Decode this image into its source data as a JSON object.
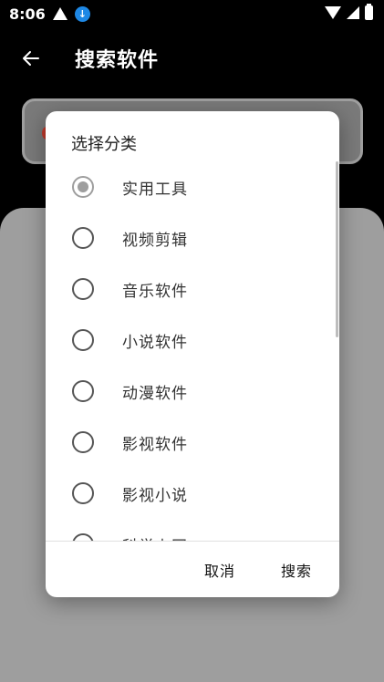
{
  "status_bar": {
    "time": "8:06",
    "icons": [
      "alert-icon",
      "download-icon",
      "wifi-icon",
      "signal-icon",
      "battery-icon"
    ]
  },
  "app_bar": {
    "title": "搜索软件",
    "back_icon": "back-arrow-icon"
  },
  "dialog": {
    "title": "选择分类",
    "options": [
      {
        "label": "实用工具",
        "checked": true
      },
      {
        "label": "视频剪辑",
        "checked": false
      },
      {
        "label": "音乐软件",
        "checked": false
      },
      {
        "label": "小说软件",
        "checked": false
      },
      {
        "label": "动漫软件",
        "checked": false
      },
      {
        "label": "影视软件",
        "checked": false
      },
      {
        "label": "影视小说",
        "checked": false
      },
      {
        "label": "科学上网",
        "checked": false
      }
    ],
    "cancel_label": "取消",
    "search_label": "搜索"
  },
  "colors": {
    "radio_checked": "#9e9e9e",
    "status_download": "#1e88e5",
    "content_panel": "#9e9e9e"
  }
}
